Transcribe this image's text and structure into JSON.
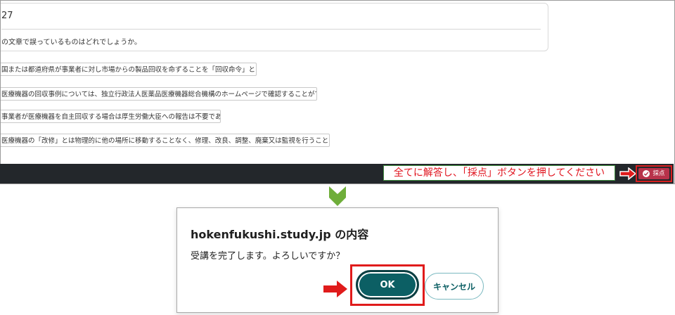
{
  "question": {
    "number": "27",
    "text": "の文章で誤っているものはどれでしょうか。"
  },
  "options": [
    "国または都道府県が事業者に対し市場からの製品回収を命ずることを「回収命令」という。",
    "医療機器の回収事例については、独立行政法人医薬品医療機器総合機構のホームページで確認することができる。",
    "事業者が医療機器を自主回収する場合は厚生労働大臣への報告は不要である。",
    "医療機器の「改修」とは物理的に他の場所に移動することなく、修理、改良、調整、廃棄又は監視を行うことを言う。"
  ],
  "instruction": "全てに解答し、「採点」ボタンを押してください",
  "score_button": {
    "label": "採点",
    "icon": "check-circle-icon"
  },
  "dialog": {
    "title": "hokenfukushi.study.jp の内容",
    "message": "受講を完了します。よろしいですか？",
    "ok_label": "OK",
    "cancel_label": "キャンセル"
  },
  "colors": {
    "accent_red": "#e01b1b",
    "ok_teal": "#0c5f64",
    "bar_dark": "#23272b",
    "score_button": "#b8324a",
    "guide_arrow_green": "#6fae3a"
  }
}
